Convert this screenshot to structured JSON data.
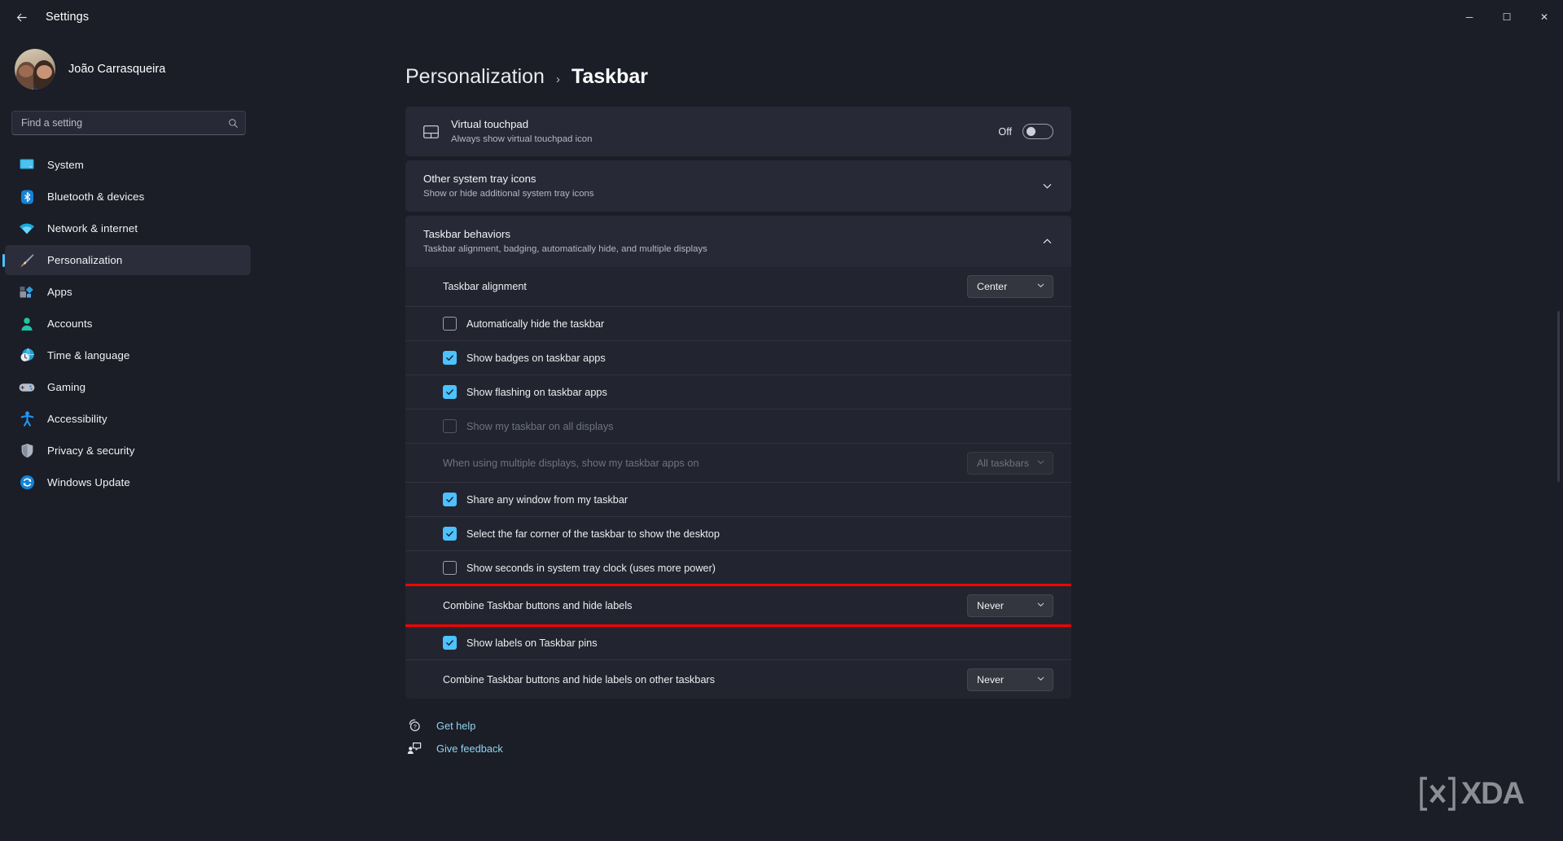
{
  "window": {
    "title": "Settings",
    "back_icon": "back-arrow-icon",
    "minimize": "─",
    "maximize": "☐",
    "close": "✕"
  },
  "sidebar": {
    "profile_name": "João Carrasqueira",
    "search": {
      "placeholder": "Find a setting",
      "value": "",
      "icon": "search-icon"
    },
    "items": [
      {
        "label": "System",
        "icon": "monitor-icon",
        "active": false
      },
      {
        "label": "Bluetooth & devices",
        "icon": "bluetooth-icon",
        "active": false
      },
      {
        "label": "Network & internet",
        "icon": "wifi-icon",
        "active": false
      },
      {
        "label": "Personalization",
        "icon": "paintbrush-icon",
        "active": true
      },
      {
        "label": "Apps",
        "icon": "apps-icon",
        "active": false
      },
      {
        "label": "Accounts",
        "icon": "person-icon",
        "active": false
      },
      {
        "label": "Time & language",
        "icon": "clock-globe-icon",
        "active": false
      },
      {
        "label": "Gaming",
        "icon": "gamepad-icon",
        "active": false
      },
      {
        "label": "Accessibility",
        "icon": "accessibility-icon",
        "active": false
      },
      {
        "label": "Privacy & security",
        "icon": "shield-icon",
        "active": false
      },
      {
        "label": "Windows Update",
        "icon": "update-icon",
        "active": false
      }
    ]
  },
  "breadcrumb": {
    "parent": "Personalization",
    "separator": "›",
    "current": "Taskbar"
  },
  "cards": {
    "virtual_touchpad": {
      "title": "Virtual touchpad",
      "subtitle": "Always show virtual touchpad icon",
      "icon": "touchpad-icon",
      "toggle_label": "Off",
      "toggle_on": false
    },
    "other_tray_icons": {
      "title": "Other system tray icons",
      "subtitle": "Show or hide additional system tray icons",
      "chevron": "chevron-down-icon",
      "expanded": false
    },
    "taskbar_behaviors": {
      "title": "Taskbar behaviors",
      "subtitle": "Taskbar alignment, badging, automatically hide, and multiple displays",
      "chevron": "chevron-up-icon",
      "expanded": true
    }
  },
  "behavior_rows": [
    {
      "type": "dropdown",
      "label": "Taskbar alignment",
      "value": "Center",
      "disabled": false,
      "highlighted": false
    },
    {
      "type": "checkbox",
      "label": "Automatically hide the taskbar",
      "checked": false,
      "disabled": false,
      "highlighted": false
    },
    {
      "type": "checkbox",
      "label": "Show badges on taskbar apps",
      "checked": true,
      "disabled": false,
      "highlighted": false
    },
    {
      "type": "checkbox",
      "label": "Show flashing on taskbar apps",
      "checked": true,
      "disabled": false,
      "highlighted": false
    },
    {
      "type": "checkbox",
      "label": "Show my taskbar on all displays",
      "checked": false,
      "disabled": true,
      "highlighted": false
    },
    {
      "type": "dropdown",
      "label": "When using multiple displays, show my taskbar apps on",
      "value": "All taskbars",
      "disabled": true,
      "highlighted": false
    },
    {
      "type": "checkbox",
      "label": "Share any window from my taskbar",
      "checked": true,
      "disabled": false,
      "highlighted": false
    },
    {
      "type": "checkbox",
      "label": "Select the far corner of the taskbar to show the desktop",
      "checked": true,
      "disabled": false,
      "highlighted": false
    },
    {
      "type": "checkbox",
      "label": "Show seconds in system tray clock (uses more power)",
      "checked": false,
      "disabled": false,
      "highlighted": false
    },
    {
      "type": "dropdown",
      "label": "Combine Taskbar buttons and hide labels",
      "value": "Never",
      "disabled": false,
      "highlighted": true
    },
    {
      "type": "checkbox",
      "label": "Show labels on Taskbar pins",
      "checked": true,
      "disabled": false,
      "highlighted": false
    },
    {
      "type": "dropdown",
      "label": "Combine Taskbar buttons and hide labels on other taskbars",
      "value": "Never",
      "disabled": false,
      "highlighted": false
    }
  ],
  "footer": {
    "links": [
      {
        "label": "Get help",
        "icon": "help-icon"
      },
      {
        "label": "Give feedback",
        "icon": "feedback-icon"
      }
    ]
  },
  "watermark": {
    "text": "XDA",
    "icon": "xda-logo-icon"
  },
  "colors": {
    "accent": "#4cc2ff",
    "highlight": "#ff0000",
    "background": "#1b1d27",
    "card": "#272a36",
    "link": "#8fd5f0"
  }
}
